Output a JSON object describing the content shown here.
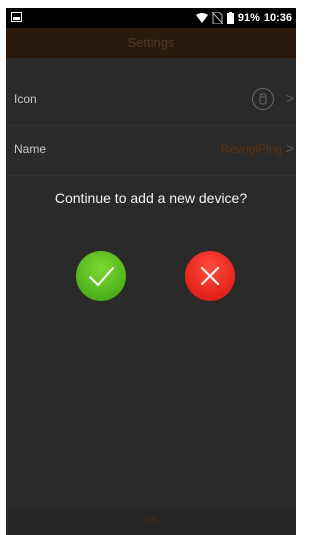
{
  "status_bar": {
    "battery": "91%",
    "time": "10:36"
  },
  "header": {
    "title": "Settings"
  },
  "settings": {
    "icon_label": "Icon",
    "name_label": "Name",
    "name_value": "RevogiPlug",
    "chevron": ">"
  },
  "dialog": {
    "message": "Continue to add a new device?"
  },
  "footer": {
    "ok_label": "OK"
  },
  "colors": {
    "confirm": "#55b81e",
    "cancel": "#e8281e",
    "header_bg": "#2b1a0b"
  }
}
